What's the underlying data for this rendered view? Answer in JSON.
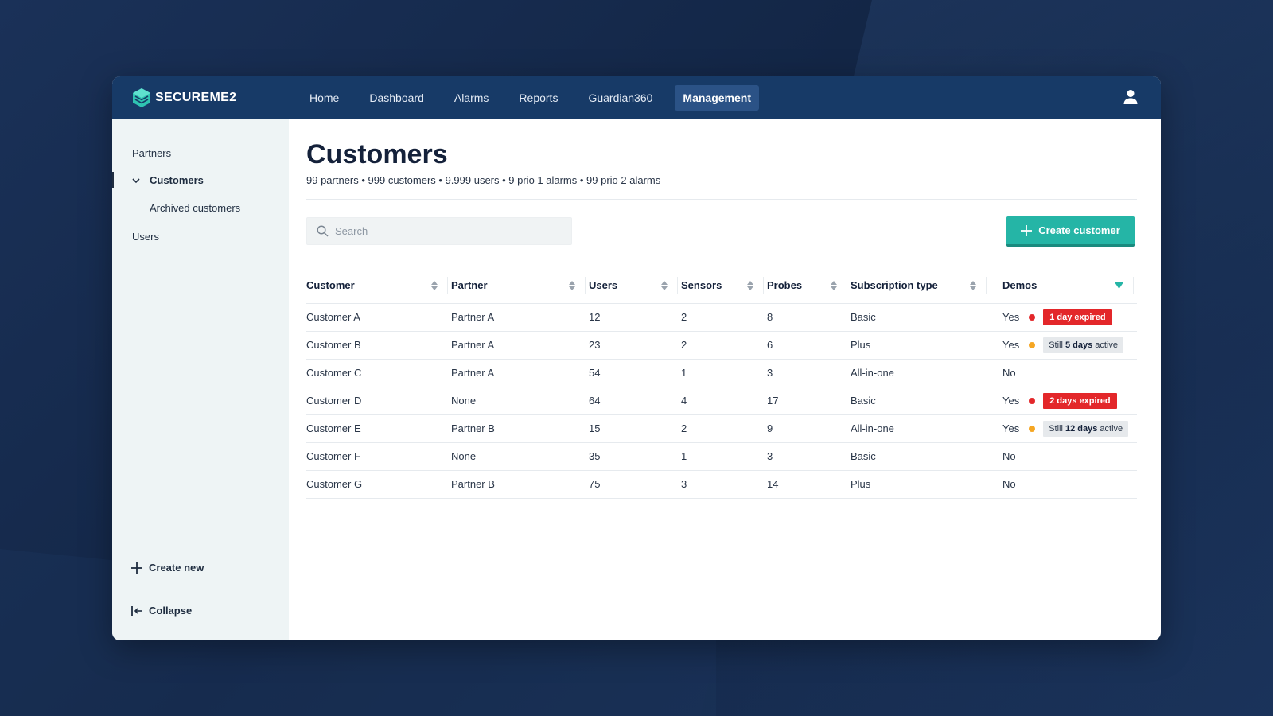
{
  "colors": {
    "accent": "#25b5a6",
    "topbar": "#173a67",
    "expired": "#e3272a",
    "warning": "#f5a623",
    "sidebar": "#eef4f5"
  },
  "brand": {
    "name": "SECUREME2",
    "icon": "logo-cube-icon"
  },
  "nav": {
    "items": [
      {
        "label": "Home",
        "active": false
      },
      {
        "label": "Dashboard",
        "active": false
      },
      {
        "label": "Alarms",
        "active": false
      },
      {
        "label": "Reports",
        "active": false
      },
      {
        "label": "Guardian360",
        "active": false
      },
      {
        "label": "Management",
        "active": true
      }
    ],
    "user_icon": "user-icon"
  },
  "sidebar": {
    "items": [
      {
        "label": "Partners"
      },
      {
        "label": "Customers",
        "expanded": true,
        "active": true
      },
      {
        "label": "Archived customers",
        "sub": true
      },
      {
        "label": "Users"
      }
    ],
    "create_new": "Create new",
    "collapse": "Collapse"
  },
  "page": {
    "title": "Customers",
    "subtitle": "99 partners • 999 customers • 9.999 users • 9 prio 1 alarms • 99 prio 2 alarms"
  },
  "search": {
    "placeholder": "Search",
    "value": ""
  },
  "create_button": "Create customer",
  "table": {
    "columns": [
      "Customer",
      "Partner",
      "Users",
      "Sensors",
      "Probes",
      "Subscription type",
      "Demos"
    ],
    "rows": [
      {
        "customer": "Customer A",
        "partner": "Partner A",
        "users": "12",
        "sensors": "2",
        "probes": "8",
        "subscription": "Basic",
        "demo": "Yes",
        "status": "expired",
        "badge_pre": "",
        "badge_bold": "1 day expired",
        "badge_post": ""
      },
      {
        "customer": "Customer B",
        "partner": "Partner A",
        "users": "23",
        "sensors": "2",
        "probes": "6",
        "subscription": "Plus",
        "demo": "Yes",
        "status": "active",
        "badge_pre": "Still ",
        "badge_bold": "5 days",
        "badge_post": " active"
      },
      {
        "customer": "Customer C",
        "partner": "Partner A",
        "users": "54",
        "sensors": "1",
        "probes": "3",
        "subscription": "All-in-one",
        "demo": "No",
        "status": "none",
        "badge_pre": "",
        "badge_bold": "",
        "badge_post": ""
      },
      {
        "customer": "Customer D",
        "partner": "None",
        "users": "64",
        "sensors": "4",
        "probes": "17",
        "subscription": "Basic",
        "demo": "Yes",
        "status": "expired",
        "badge_pre": "",
        "badge_bold": "2 days expired",
        "badge_post": ""
      },
      {
        "customer": "Customer E",
        "partner": "Partner B",
        "users": "15",
        "sensors": "2",
        "probes": "9",
        "subscription": "All-in-one",
        "demo": "Yes",
        "status": "active",
        "badge_pre": "Still ",
        "badge_bold": "12 days",
        "badge_post": " active"
      },
      {
        "customer": "Customer F",
        "partner": "None",
        "users": "35",
        "sensors": "1",
        "probes": "3",
        "subscription": "Basic",
        "demo": "No",
        "status": "none",
        "badge_pre": "",
        "badge_bold": "",
        "badge_post": ""
      },
      {
        "customer": "Customer G",
        "partner": "Partner B",
        "users": "75",
        "sensors": "3",
        "probes": "14",
        "subscription": "Plus",
        "demo": "No",
        "status": "none",
        "badge_pre": "",
        "badge_bold": "",
        "badge_post": ""
      }
    ]
  }
}
